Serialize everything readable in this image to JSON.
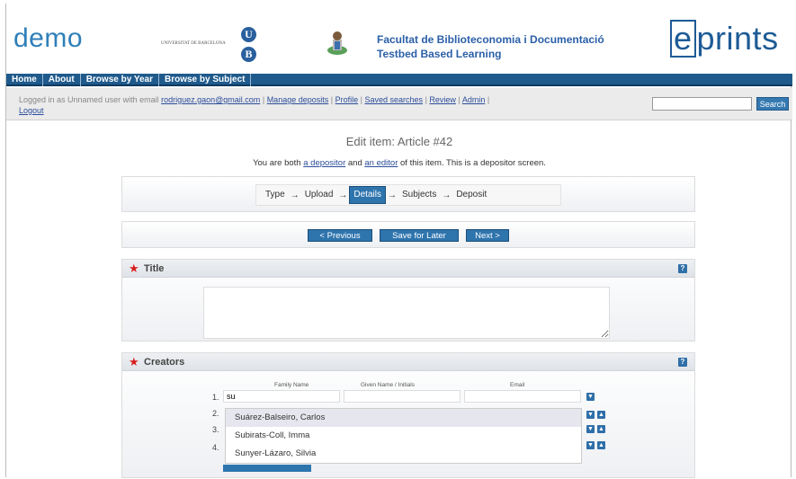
{
  "header": {
    "site_name": "demo",
    "university_text": "UNIVERSITAT DE BARCELONA",
    "ub_letter_u": "U",
    "ub_letter_b": "B",
    "faculty_line1": "Facultat de Biblioteconomia i Documentació",
    "faculty_line2": "Testbed Based Learning",
    "eprints_e": "e",
    "eprints_rest": "prints"
  },
  "nav": {
    "items": [
      "Home",
      "About",
      "Browse by Year",
      "Browse by Subject"
    ]
  },
  "login": {
    "prefix": "Logged in as Unnamed user with email",
    "email": "rodriguez.gaon@gmail.com",
    "links": [
      "Manage deposits",
      "Profile",
      "Saved searches",
      "Review",
      "Admin"
    ],
    "logout": "Logout",
    "search_value": "",
    "search_button": "Search"
  },
  "main": {
    "edit_title": "Edit item: Article #42",
    "info_prefix": "You are both ",
    "info_depositor": "a depositor",
    "info_middle": " and ",
    "info_editor": "an editor",
    "info_suffix": " of this item. This is a depositor screen.",
    "workflow": [
      "Type",
      "Upload",
      "Details",
      "Subjects",
      "Deposit"
    ],
    "workflow_active": "Details",
    "buttons": {
      "previous": "< Previous",
      "save_later": "Save for Later",
      "next": "Next >"
    },
    "title_section": {
      "label": "Title",
      "value": ""
    },
    "creators_section": {
      "label": "Creators",
      "columns": [
        "Family Name",
        "Given Name / Initials",
        "Email"
      ],
      "rows": [
        {
          "num": "1.",
          "family": "su",
          "given": "",
          "email": ""
        },
        {
          "num": "2.",
          "family": "",
          "given": "",
          "email": ""
        },
        {
          "num": "3.",
          "family": "",
          "given": "",
          "email": ""
        },
        {
          "num": "4.",
          "family": "",
          "given": "",
          "email": ""
        }
      ],
      "suggestions": [
        "Suárez-Balseiro, Carlos",
        "Subirats-Coll, Imma",
        "Sunyer-Lázaro, Silvia"
      ]
    }
  },
  "icons": {
    "required_star": "star-icon",
    "help": "help-icon",
    "move_up": "up-arrow-icon",
    "move_down": "down-arrow-icon"
  },
  "colors": {
    "nav_bg": "#1f5a8c",
    "button_bg": "#2e74ad",
    "required_star": "#d81e1e",
    "brand_blue": "#2f7fb8"
  }
}
